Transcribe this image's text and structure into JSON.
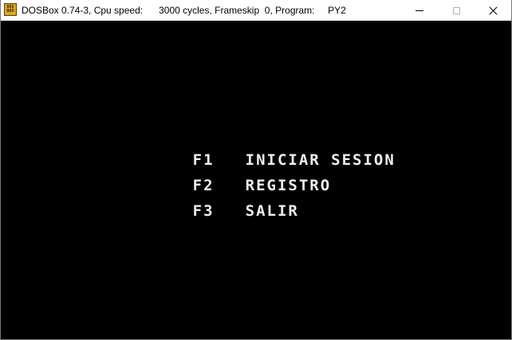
{
  "window": {
    "title": "DOSBox 0.74-3, Cpu speed:      3000 cycles, Frameskip  0, Program:     PY2",
    "icon": "dosbox-icon"
  },
  "controls": {
    "minimize": "minimize-icon",
    "maximize": "maximize-icon",
    "close": "close-icon"
  },
  "menu": {
    "items": [
      {
        "key": "F1",
        "label": "INICIAR SESION"
      },
      {
        "key": "F2",
        "label": "REGISTRO"
      },
      {
        "key": "F3",
        "label": "SALIR"
      }
    ]
  },
  "colors": {
    "screen_bg": "#000000",
    "text": "#eeeeee",
    "titlebar_bg": "#ffffff"
  }
}
